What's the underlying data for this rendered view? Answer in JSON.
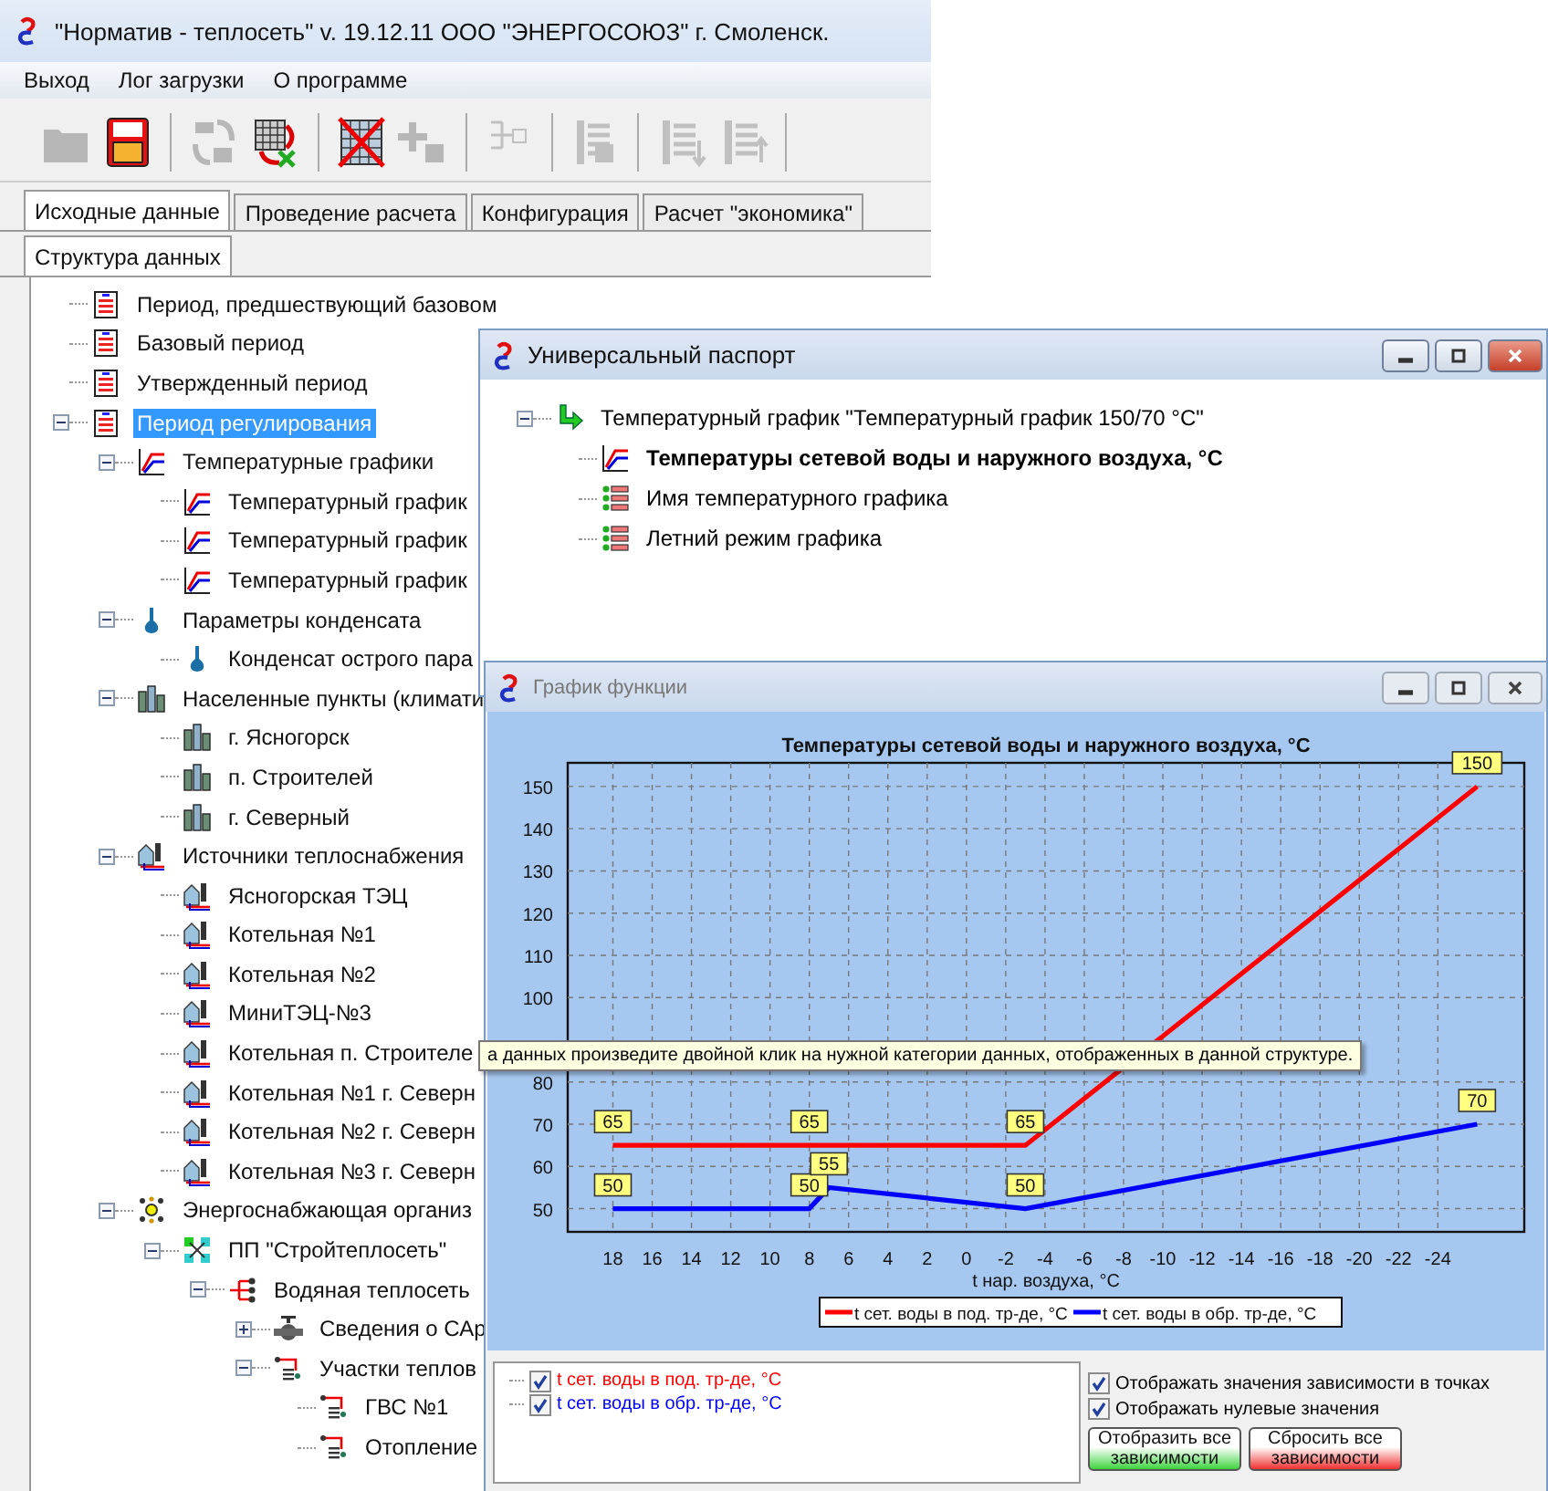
{
  "main_window": {
    "title": "\"Норматив - теплосеть\" v. 19.12.11 ООО \"ЭНЕРГОСОЮЗ\" г. Смоленск.",
    "menu": [
      "Выход",
      "Лог загрузки",
      "О программе"
    ],
    "toolbar": [
      {
        "kind": "folder",
        "disabled": true
      },
      {
        "kind": "save",
        "disabled": false
      },
      {
        "kind": "separator"
      },
      {
        "kind": "refresh",
        "disabled": true
      },
      {
        "kind": "grid-refresh",
        "disabled": false
      },
      {
        "kind": "separator"
      },
      {
        "kind": "grid-delete",
        "disabled": false
      },
      {
        "kind": "add",
        "disabled": true
      },
      {
        "kind": "separator"
      },
      {
        "kind": "tree",
        "disabled": true
      },
      {
        "kind": "separator"
      },
      {
        "kind": "list-edit",
        "disabled": true
      },
      {
        "kind": "separator"
      },
      {
        "kind": "list-down",
        "disabled": true
      },
      {
        "kind": "list-up",
        "disabled": true
      },
      {
        "kind": "separator"
      }
    ],
    "tabs": [
      {
        "label": "Исходные данные",
        "selected": true
      },
      {
        "label": "Проведение расчета",
        "selected": false
      },
      {
        "label": "Конфигурация",
        "selected": false
      },
      {
        "label": "Расчет \"экономика\"",
        "selected": false
      }
    ],
    "subtabs": [
      {
        "label": "Структура данных",
        "selected": true
      }
    ],
    "tree": [
      {
        "label": "Период, предшествующий базовом",
        "kind": "period",
        "selected": false
      },
      {
        "label": "Базовый период",
        "kind": "period",
        "selected": false
      },
      {
        "label": "Утвержденный период",
        "kind": "period",
        "selected": false
      },
      {
        "label": "Период регулирования",
        "kind": "period",
        "selected": true,
        "expanded": true,
        "children": [
          {
            "label": "Температурные графики",
            "kind": "tgraph",
            "selected": false,
            "expanded": true,
            "children": [
              {
                "label": "Температурный график",
                "kind": "tgraph",
                "selected": false
              },
              {
                "label": "Температурный график",
                "kind": "tgraph",
                "selected": false
              },
              {
                "label": "Температурный график",
                "kind": "tgraph",
                "selected": false
              }
            ]
          },
          {
            "label": "Параметры конденсата",
            "kind": "drop",
            "selected": false,
            "expanded": true,
            "children": [
              {
                "label": "Конденсат острого пара",
                "kind": "drop",
                "selected": false
              }
            ]
          },
          {
            "label": "Населенные пункты (климати",
            "kind": "city",
            "selected": false,
            "expanded": true,
            "children": [
              {
                "label": "г. Ясногорск",
                "kind": "city",
                "selected": false
              },
              {
                "label": "п. Строителей",
                "kind": "city",
                "selected": false
              },
              {
                "label": "г. Северный",
                "kind": "city",
                "selected": false
              }
            ]
          },
          {
            "label": "Источники теплоснабжения",
            "kind": "source",
            "selected": false,
            "expanded": true,
            "children": [
              {
                "label": "Ясногорская ТЭЦ",
                "kind": "source",
                "selected": false
              },
              {
                "label": "Котельная №1",
                "kind": "source",
                "selected": false
              },
              {
                "label": "Котельная №2",
                "kind": "source",
                "selected": false
              },
              {
                "label": "МиниТЭЦ-№3",
                "kind": "source",
                "selected": false
              },
              {
                "label": "Котельная п. Строителе",
                "kind": "source",
                "selected": false
              },
              {
                "label": "Котельная №1 г. Северн",
                "kind": "source",
                "selected": false
              },
              {
                "label": "Котельная №2 г. Северн",
                "kind": "source",
                "selected": false
              },
              {
                "label": "Котельная №3 г. Северн",
                "kind": "source",
                "selected": false
              }
            ]
          },
          {
            "label": "Энергоснабжающая организ",
            "kind": "org",
            "selected": false,
            "expanded": true,
            "children": [
              {
                "label": "ПП \"Стройтеплосеть\"",
                "kind": "enterprise",
                "selected": false,
                "expanded": true,
                "children": [
                  {
                    "label": "Водяная теплосеть",
                    "kind": "network",
                    "selected": false,
                    "expanded": true,
                    "children": [
                      {
                        "label": "Сведения о САр",
                        "kind": "valve",
                        "selected": false,
                        "expanded": false
                      },
                      {
                        "label": "Участки теплов",
                        "kind": "section",
                        "selected": false,
                        "expanded": true,
                        "children": [
                          {
                            "label": "ГВС №1",
                            "kind": "section",
                            "selected": false
                          },
                          {
                            "label": "Отопление",
                            "kind": "section",
                            "selected": false
                          }
                        ]
                      }
                    ]
                  }
                ]
              }
            ]
          }
        ]
      }
    ]
  },
  "passport_window": {
    "title": "Универсальный паспорт",
    "tree": [
      {
        "label": "Температурный график \"Температурный график 150/70 °С\"",
        "kind": "root",
        "expanded": true,
        "children": [
          {
            "label": "Температуры сетевой воды и наружного воздуха, °С",
            "kind": "function"
          },
          {
            "label": "Имя температурного графика",
            "kind": "field"
          },
          {
            "label": "Летний режим графика",
            "kind": "field"
          }
        ]
      }
    ]
  },
  "function_window": {
    "title": "График функции",
    "chart_data": {
      "type": "line",
      "title": "Температуры сетевой воды и наружного воздуха, °С",
      "xlabel": "t нар. воздуха, °С",
      "x": [
        18,
        8,
        7,
        -3,
        -26
      ],
      "series": [
        {
          "name": "t сет. воды в под. тр-де, °С",
          "color": "#ff0000",
          "values": [
            65,
            65,
            null,
            65,
            150
          ]
        },
        {
          "name": "t сет. воды в обр. тр-де, °С",
          "color": "#0000ff",
          "values": [
            50,
            50,
            55,
            50,
            70
          ]
        }
      ],
      "xlim": [
        20.3,
        -28.4
      ],
      "ylim": [
        44.5,
        155.6
      ],
      "xticks": [
        18,
        16,
        14,
        12,
        10,
        8,
        6,
        4,
        2,
        0,
        -2,
        -4,
        -6,
        -8,
        -10,
        -12,
        -14,
        -16,
        -18,
        -20,
        -22,
        -24
      ],
      "yticks": [
        50,
        60,
        70,
        80,
        100,
        110,
        120,
        130,
        140,
        150
      ],
      "grid": true,
      "legend": true,
      "data_labels": true
    },
    "series_list": [
      {
        "label": "t сет. воды в под. тр-де, °С",
        "checked": true,
        "color": "#ff0000"
      },
      {
        "label": "t сет. воды в обр. тр-де, °С",
        "checked": true,
        "color": "#0000ff"
      }
    ],
    "options": [
      {
        "label": "Отображать значения зависимости в точках",
        "checked": true
      },
      {
        "label": "Отображать нулевые значения",
        "checked": true
      }
    ],
    "buttons": [
      {
        "label": "Отобразить все зависимости",
        "kind": "show"
      },
      {
        "label": "Сбросить все зависимости",
        "kind": "reset"
      }
    ]
  },
  "tooltip": {
    "text": "а данных произведите двойной клик на нужной категории данных, отображенных в данной структуре."
  }
}
